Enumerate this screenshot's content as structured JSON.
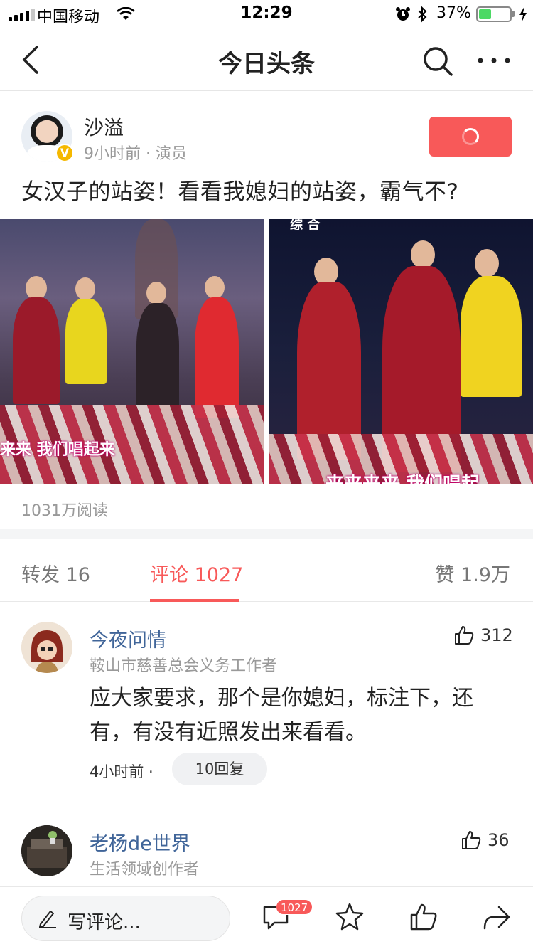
{
  "status_bar": {
    "carrier": "中国移动",
    "time": "12:29",
    "battery_percent": "37%",
    "battery_level": 0.37
  },
  "nav": {
    "title": "今日头条",
    "back_icon": "back-chevron-icon",
    "search_icon": "search-icon",
    "more_icon": "more-dots-icon"
  },
  "post": {
    "author_name": "沙溢",
    "author_meta": "9小时前 · 演员",
    "text": "女汉子的站姿！看看我媳妇的站姿，霸气不?",
    "image_1_caption": "来来 我们唱起来",
    "image_2_caption": "来来来来 我们唱起",
    "image_2_logo": "综 合",
    "reads": "1031万阅读"
  },
  "tabs": {
    "repost": "转发 16",
    "comments": "评论 1027",
    "likes": "赞 1.9万"
  },
  "comments": [
    {
      "name": "今夜问情",
      "role": "鞍山市慈善总会义务工作者",
      "likes": "312",
      "text": "应大家要求，那个是你媳妇，标注下，还有，有没有近照发出来看看。",
      "time": "4小时前 ·",
      "replies": "10回复"
    },
    {
      "name": "老杨de世界",
      "role": "生活领域创作者",
      "likes": "36"
    }
  ],
  "bottom_bar": {
    "write_comment": "写评论...",
    "comment_count": "1027"
  },
  "colors": {
    "accent": "#f85959",
    "link_name": "#406599",
    "muted": "#999999"
  }
}
